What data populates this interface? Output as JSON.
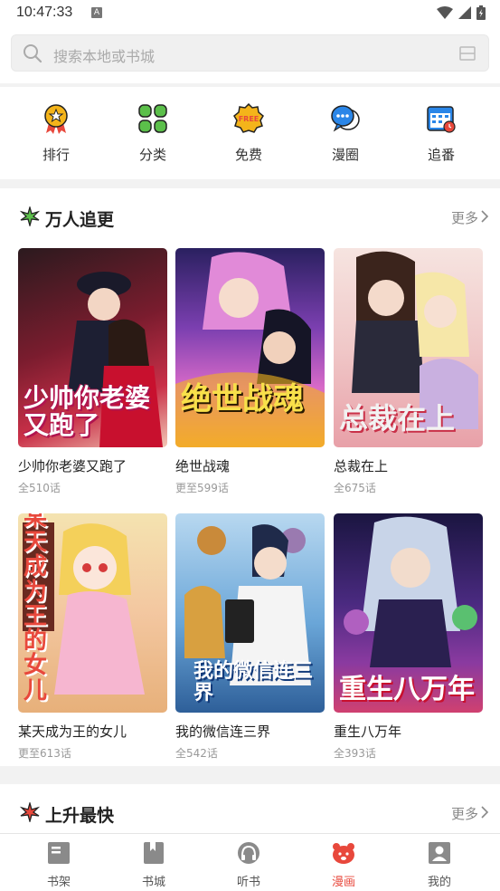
{
  "status_bar": {
    "time": "10:47:33",
    "indicator": "A"
  },
  "search": {
    "placeholder": "搜索本地或书城"
  },
  "quick_nav": [
    {
      "label": "排行",
      "icon": "ranking-medal-icon"
    },
    {
      "label": "分类",
      "icon": "category-grid-icon"
    },
    {
      "label": "免费",
      "icon": "free-badge-icon"
    },
    {
      "label": "漫圈",
      "icon": "chat-bubble-icon"
    },
    {
      "label": "追番",
      "icon": "calendar-icon"
    }
  ],
  "section_popular": {
    "title": "万人追更",
    "more": "更多",
    "items": [
      {
        "title": "少帅你老婆又跑了",
        "sub": "全510话",
        "cover_text": "少帅你老婆又跑了",
        "cover_color": "#a8324a"
      },
      {
        "title": "绝世战魂",
        "sub": "更至599话",
        "cover_text": "绝世战魂",
        "cover_color": "#5a3fa0"
      },
      {
        "title": "总裁在上",
        "sub": "全675话",
        "cover_text": "总裁在上",
        "cover_color": "#c9808a"
      },
      {
        "title": "某天成为王的女儿",
        "sub": "更至613话",
        "cover_text": "某天成为王的女儿",
        "cover_color": "#d7a76a"
      },
      {
        "title": "我的微信连三界",
        "sub": "全542话",
        "cover_text": "我的微信连三界",
        "cover_color": "#3f7fb3"
      },
      {
        "title": "重生八万年",
        "sub": "全393话",
        "cover_text": "重生八万年",
        "cover_color": "#3b2a6a"
      }
    ]
  },
  "section_rising": {
    "title": "上升最快",
    "more": "更多"
  },
  "tabbar": [
    {
      "label": "书架",
      "icon": "bookshelf-icon",
      "active": false
    },
    {
      "label": "书城",
      "icon": "bookstore-icon",
      "active": false
    },
    {
      "label": "听书",
      "icon": "headphones-icon",
      "active": false
    },
    {
      "label": "漫画",
      "icon": "comic-bear-icon",
      "active": true
    },
    {
      "label": "我的",
      "icon": "profile-icon",
      "active": false
    }
  ],
  "colors": {
    "accent": "#e8483c",
    "gold": "#f4b41a",
    "green": "#5bbf4a",
    "blue": "#2a86e8"
  }
}
